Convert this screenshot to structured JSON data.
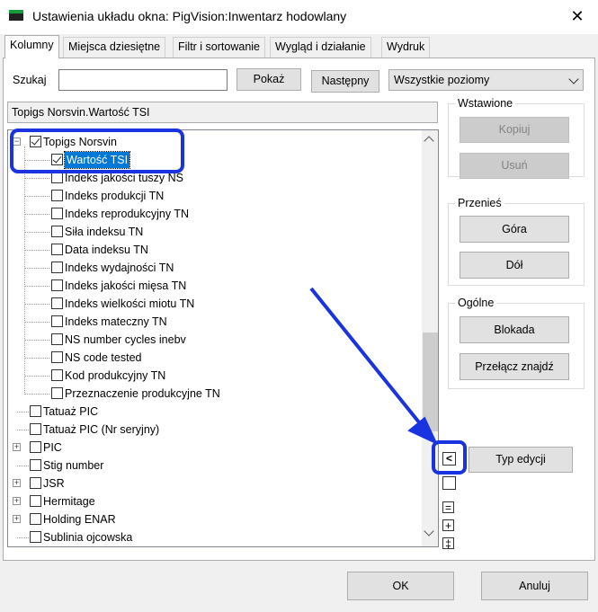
{
  "window": {
    "title": "Ustawienia układu okna: PigVision:Inwentarz hodowlany",
    "close_glyph": "✕"
  },
  "tabs": [
    {
      "label": "Kolumny",
      "active": true
    },
    {
      "label": "Miejsca dziesiętne",
      "active": false
    },
    {
      "label": "Filtr i sortowanie",
      "active": false
    },
    {
      "label": "Wygląd i działanie",
      "active": false
    },
    {
      "label": "Wydruk",
      "active": false
    }
  ],
  "search": {
    "label": "Szukaj",
    "value": "",
    "show_button": "Pokaż",
    "next_button": "Następny",
    "level_select": "Wszystkie poziomy"
  },
  "path": "Topigs Norsvin.Wartość TSI",
  "tree": {
    "items": [
      {
        "label": "Topigs Norsvin",
        "checked": true,
        "expander": "minus",
        "level": 0
      },
      {
        "label": "Wartość TSI",
        "checked": true,
        "selected": true,
        "level": 1
      },
      {
        "label": "Indeks jakości tuszy NS",
        "checked": false,
        "level": 1
      },
      {
        "label": "Indeks produkcji TN",
        "checked": false,
        "level": 1
      },
      {
        "label": "Indeks reprodukcyjny TN",
        "checked": false,
        "level": 1
      },
      {
        "label": "Siła indeksu TN",
        "checked": false,
        "level": 1
      },
      {
        "label": "Data indeksu TN",
        "checked": false,
        "level": 1
      },
      {
        "label": "Indeks wydajności TN",
        "checked": false,
        "level": 1
      },
      {
        "label": "Indeks jakości mięsa TN",
        "checked": false,
        "level": 1
      },
      {
        "label": "Indeks wielkości miotu TN",
        "checked": false,
        "level": 1
      },
      {
        "label": "Indeks mateczny TN",
        "checked": false,
        "level": 1
      },
      {
        "label": "NS number cycles inebv",
        "checked": false,
        "level": 1
      },
      {
        "label": "NS code tested",
        "checked": false,
        "level": 1
      },
      {
        "label": "Kod produkcyjny TN",
        "checked": false,
        "level": 1
      },
      {
        "label": "Przeznaczenie produkcyjne TN",
        "checked": false,
        "level": 1
      },
      {
        "label": "Tatuaż PIC",
        "checked": false,
        "level": 0
      },
      {
        "label": "Tatuaż PIC (Nr seryjny)",
        "checked": false,
        "level": 0
      },
      {
        "label": "PIC",
        "checked": false,
        "expander": "plus",
        "level": 0
      },
      {
        "label": "Stig number",
        "checked": false,
        "level": 0
      },
      {
        "label": "JSR",
        "checked": false,
        "expander": "plus",
        "level": 0
      },
      {
        "label": "Hermitage",
        "checked": false,
        "expander": "plus",
        "level": 0
      },
      {
        "label": "Holding ENAR",
        "checked": false,
        "expander": "plus",
        "level": 0
      },
      {
        "label": "Sublinia ojcowska",
        "checked": false,
        "level": 0
      }
    ]
  },
  "groups": {
    "inserted": {
      "title": "Wstawione",
      "copy": "Kopiuj",
      "delete": "Usuń"
    },
    "move": {
      "title": "Przenieś",
      "up": "Góra",
      "down": "Dół"
    },
    "general": {
      "title": "Ogólne",
      "lock": "Blokada",
      "toggle_find": "Przełącz znajdź"
    }
  },
  "edit_type_button": "Typ edycji",
  "small_buttons": {
    "collapse": "<",
    "equal": "=",
    "plus": "+",
    "updown": "‡"
  },
  "footer": {
    "ok": "OK",
    "cancel": "Anuluj"
  },
  "colors": {
    "selection": "#0078d7",
    "annotation": "#1a33e0",
    "title_icon_green": "#1a9b3a"
  }
}
